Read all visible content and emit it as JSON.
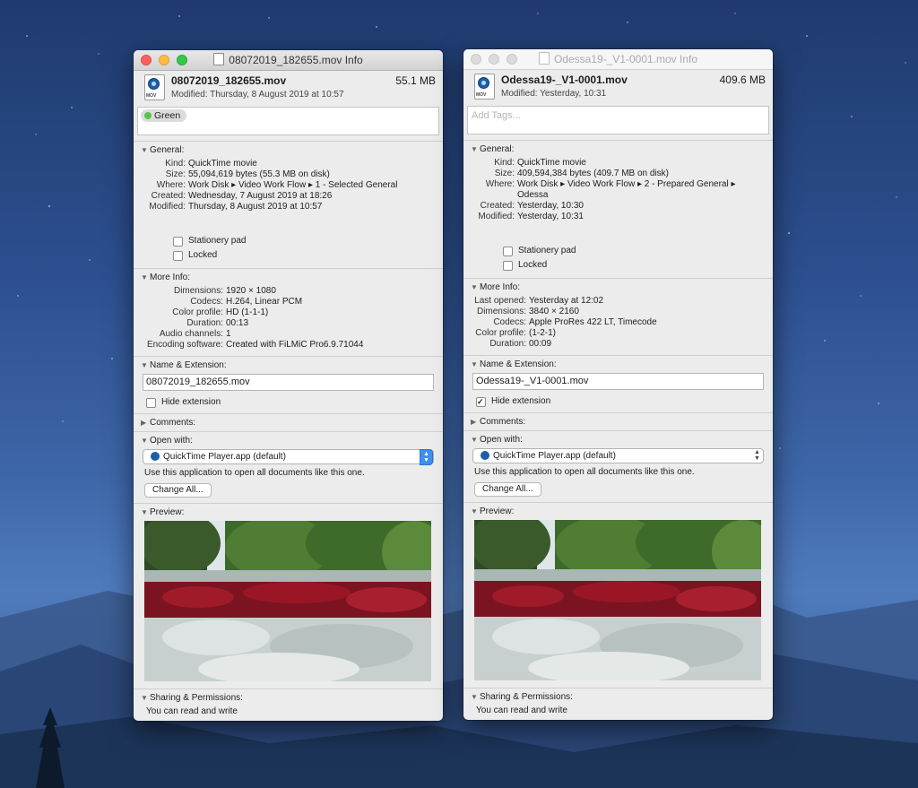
{
  "left": {
    "title": "08072019_182655.mov Info",
    "name": "08072019_182655.mov",
    "size": "55.1 MB",
    "modified_header": "Modified: Thursday, 8 August 2019 at 10:57",
    "tag": "Green",
    "sections": {
      "general": "General:",
      "more_info": "More Info:",
      "name_ext": "Name & Extension:",
      "comments": "Comments:",
      "open_with": "Open with:",
      "preview": "Preview:",
      "sharing": "Sharing & Permissions:"
    },
    "general": [
      {
        "k": "Kind:",
        "v": "QuickTime movie"
      },
      {
        "k": "Size:",
        "v": "55,094,619 bytes (55.3 MB on disk)"
      },
      {
        "k": "Where:",
        "v": "Work Disk ▸ Video Work Flow ▸ 1 - Selected General"
      },
      {
        "k": "Created:",
        "v": "Wednesday, 7 August 2019 at 18:26"
      },
      {
        "k": "Modified:",
        "v": "Thursday, 8 August 2019 at 10:57"
      }
    ],
    "stationery": "Stationery pad",
    "locked": "Locked",
    "more_info": [
      {
        "k": "Dimensions:",
        "v": "1920 × 1080"
      },
      {
        "k": "Codecs:",
        "v": "H.264, Linear PCM"
      },
      {
        "k": "Color profile:",
        "v": "HD (1-1-1)"
      },
      {
        "k": "Duration:",
        "v": "00:13"
      },
      {
        "k": "Audio channels:",
        "v": "1"
      },
      {
        "k": "Encoding software:",
        "v": "Created with FiLMiC Pro6.9.71044"
      }
    ],
    "filename_field": "08072019_182655.mov",
    "hide_extension": "Hide extension",
    "hide_extension_checked": false,
    "open_with_app": "QuickTime Player.app (default)",
    "open_with_note": "Use this application to open all documents like this one.",
    "change_all": "Change All...",
    "sharing_text": "You can read and write"
  },
  "right": {
    "title": "Odessa19-_V1-0001.mov Info",
    "name": "Odessa19-_V1-0001.mov",
    "size": "409.6 MB",
    "modified_header": "Modified: Yesterday, 10:31",
    "tags_placeholder": "Add Tags...",
    "sections": {
      "general": "General:",
      "more_info": "More Info:",
      "name_ext": "Name & Extension:",
      "comments": "Comments:",
      "open_with": "Open with:",
      "preview": "Preview:",
      "sharing": "Sharing & Permissions:"
    },
    "general": [
      {
        "k": "Kind:",
        "v": "QuickTime movie"
      },
      {
        "k": "Size:",
        "v": "409,594,384 bytes (409.7 MB on disk)"
      },
      {
        "k": "Where:",
        "v": "Work Disk ▸ Video Work Flow ▸ 2 - Prepared General ▸ Odessa"
      },
      {
        "k": "Created:",
        "v": "Yesterday, 10:30"
      },
      {
        "k": "Modified:",
        "v": "Yesterday, 10:31"
      }
    ],
    "stationery": "Stationery pad",
    "locked": "Locked",
    "more_info": [
      {
        "k": "Last opened:",
        "v": "Yesterday at 12:02"
      },
      {
        "k": "Dimensions:",
        "v": "3840 × 2160"
      },
      {
        "k": "Codecs:",
        "v": "Apple ProRes 422 LT, Timecode"
      },
      {
        "k": "Color profile:",
        "v": "(1-2-1)"
      },
      {
        "k": "Duration:",
        "v": "00:09"
      }
    ],
    "filename_field": "Odessa19-_V1-0001.mov",
    "hide_extension": "Hide extension",
    "hide_extension_checked": true,
    "open_with_app": "QuickTime Player.app (default)",
    "open_with_note": "Use this application to open all documents like this one.",
    "change_all": "Change All...",
    "sharing_text": "You can read and write"
  }
}
